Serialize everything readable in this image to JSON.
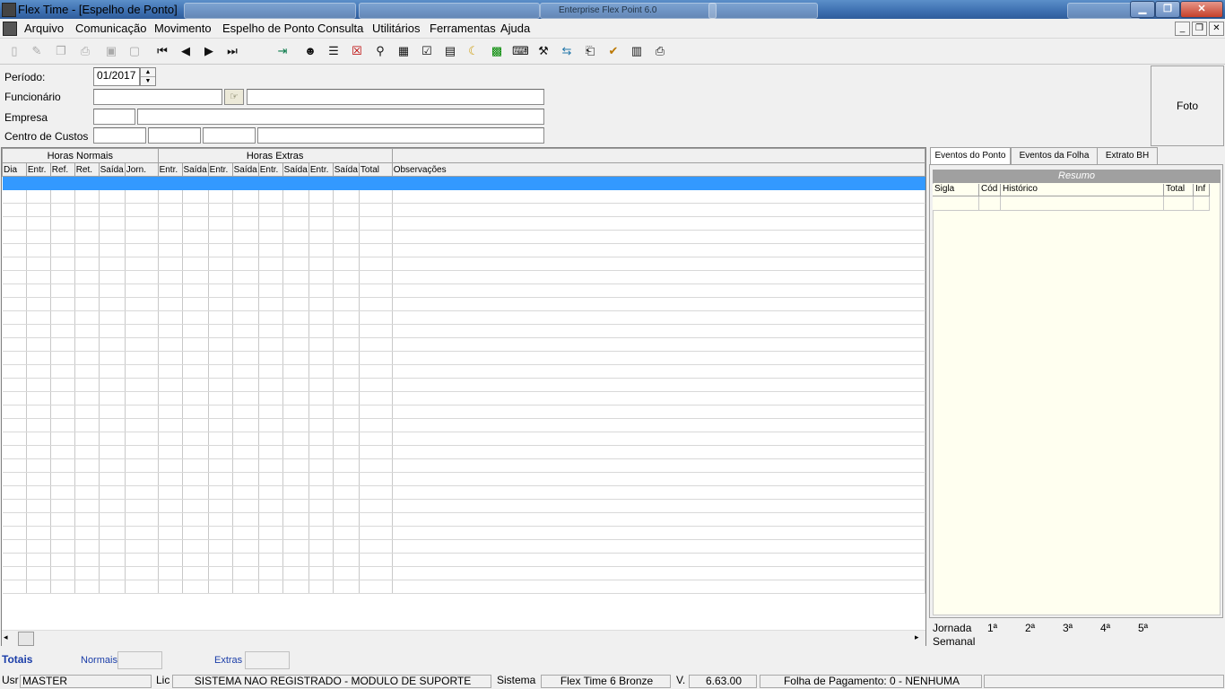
{
  "window": {
    "title": "Flex Time - [Espelho de Ponto]",
    "bg_tabs": [
      "",
      "",
      "Enterprise Flex Point 6.0"
    ]
  },
  "menu": [
    "Arquivo",
    "Comunicação",
    "Movimento",
    "Espelho de Ponto",
    "Consulta",
    "Utilitários",
    "Ferramentas",
    "Ajuda"
  ],
  "form": {
    "periodo_label": "Período:",
    "periodo_value": "01/2017",
    "funcionario_label": "Funcionário",
    "empresa_label": "Empresa",
    "centro_label": "Centro de Custos",
    "foto_label": "Foto"
  },
  "grid": {
    "group_normais": "Horas Normais",
    "group_extras": "Horas Extras",
    "columns": [
      "Dia",
      "Entr.",
      "Ref.",
      "Ret.",
      "Saída",
      "Jorn.",
      "Entr.",
      "Saída",
      "Entr.",
      "Saída",
      "Entr.",
      "Saída",
      "Entr.",
      "Saída",
      "Total",
      "Observações"
    ]
  },
  "right": {
    "tabs": [
      "Eventos do Ponto",
      "Eventos da Folha",
      "Extrato BH"
    ],
    "resumo": "Resumo",
    "cols": [
      "Sigla",
      "Cód",
      "Histórico",
      "Total",
      "Inf"
    ],
    "jornada_label": "Jornada",
    "semanal_label": "Semanal",
    "jornada_days": [
      "1ª",
      "2ª",
      "3ª",
      "4ª",
      "5ª"
    ]
  },
  "totals": {
    "totais": "Totais",
    "normais": "Normais",
    "extras": "Extras"
  },
  "status": {
    "usr_label": "Usr",
    "usr_value": "MASTER",
    "lic_label": "Lic",
    "lic_value": "SISTEMA NAO REGISTRADO - MODULO DE SUPORTE",
    "sistema_label": "Sistema",
    "sistema_value": "Flex Time 6 Bronze",
    "v_label": "V.",
    "v_value": "6.63.00",
    "folha_value": "Folha de Pagamento: 0 - NENHUMA"
  },
  "colors": {
    "selection": "#3399ff",
    "resumo_bg": "#fffff0"
  }
}
